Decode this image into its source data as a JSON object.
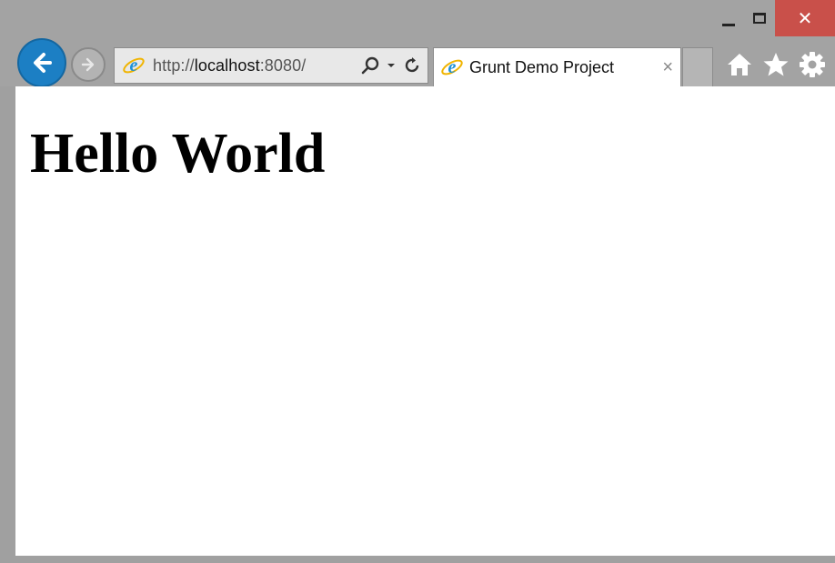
{
  "window": {
    "controls": {
      "minimize_icon": "minimize-icon",
      "maximize_icon": "maximize-icon",
      "close_label": "✕"
    }
  },
  "navigation": {
    "back_icon": "back-arrow-icon",
    "forward_icon": "forward-arrow-icon"
  },
  "address_bar": {
    "url_scheme": "http://",
    "url_host": "localhost",
    "url_port_path": ":8080/",
    "search_icon": "search-icon",
    "dropdown_icon": "chevron-down-icon",
    "refresh_icon": "refresh-icon"
  },
  "tabs": [
    {
      "title": "Grunt Demo Project",
      "close_label": "×",
      "active": true
    }
  ],
  "commands": {
    "home_icon": "home-icon",
    "favorites_icon": "star-icon",
    "settings_icon": "gear-icon"
  },
  "page": {
    "heading": "Hello World"
  },
  "colors": {
    "chrome": "#a3a3a3",
    "back_button": "#1c7fc4",
    "close_button": "#c9504a",
    "ie_blue": "#1e90d6",
    "ie_ring": "#f0b400"
  }
}
